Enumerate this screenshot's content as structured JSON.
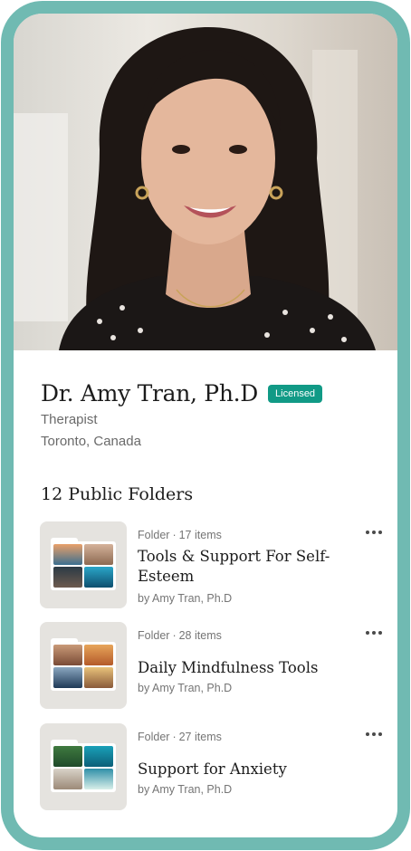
{
  "profile": {
    "name": "Dr. Amy Tran, Ph.D",
    "badge": "Licensed",
    "role": "Therapist",
    "location": "Toronto, Canada"
  },
  "folders_heading": "12 Public Folders",
  "folders": [
    {
      "type": "Folder",
      "count": "17 items",
      "title": "Tools & Support For Self-Esteem",
      "author": "by Amy Tran, Ph.D"
    },
    {
      "type": "Folder",
      "count": "28 items",
      "title": "Daily Mindfulness Tools",
      "author": "by Amy Tran, Ph.D"
    },
    {
      "type": "Folder",
      "count": "27 items",
      "title": "Support for Anxiety",
      "author": "by Amy Tran, Ph.D"
    }
  ],
  "colors": {
    "frame": "#70bab2",
    "badge": "#119a86"
  }
}
